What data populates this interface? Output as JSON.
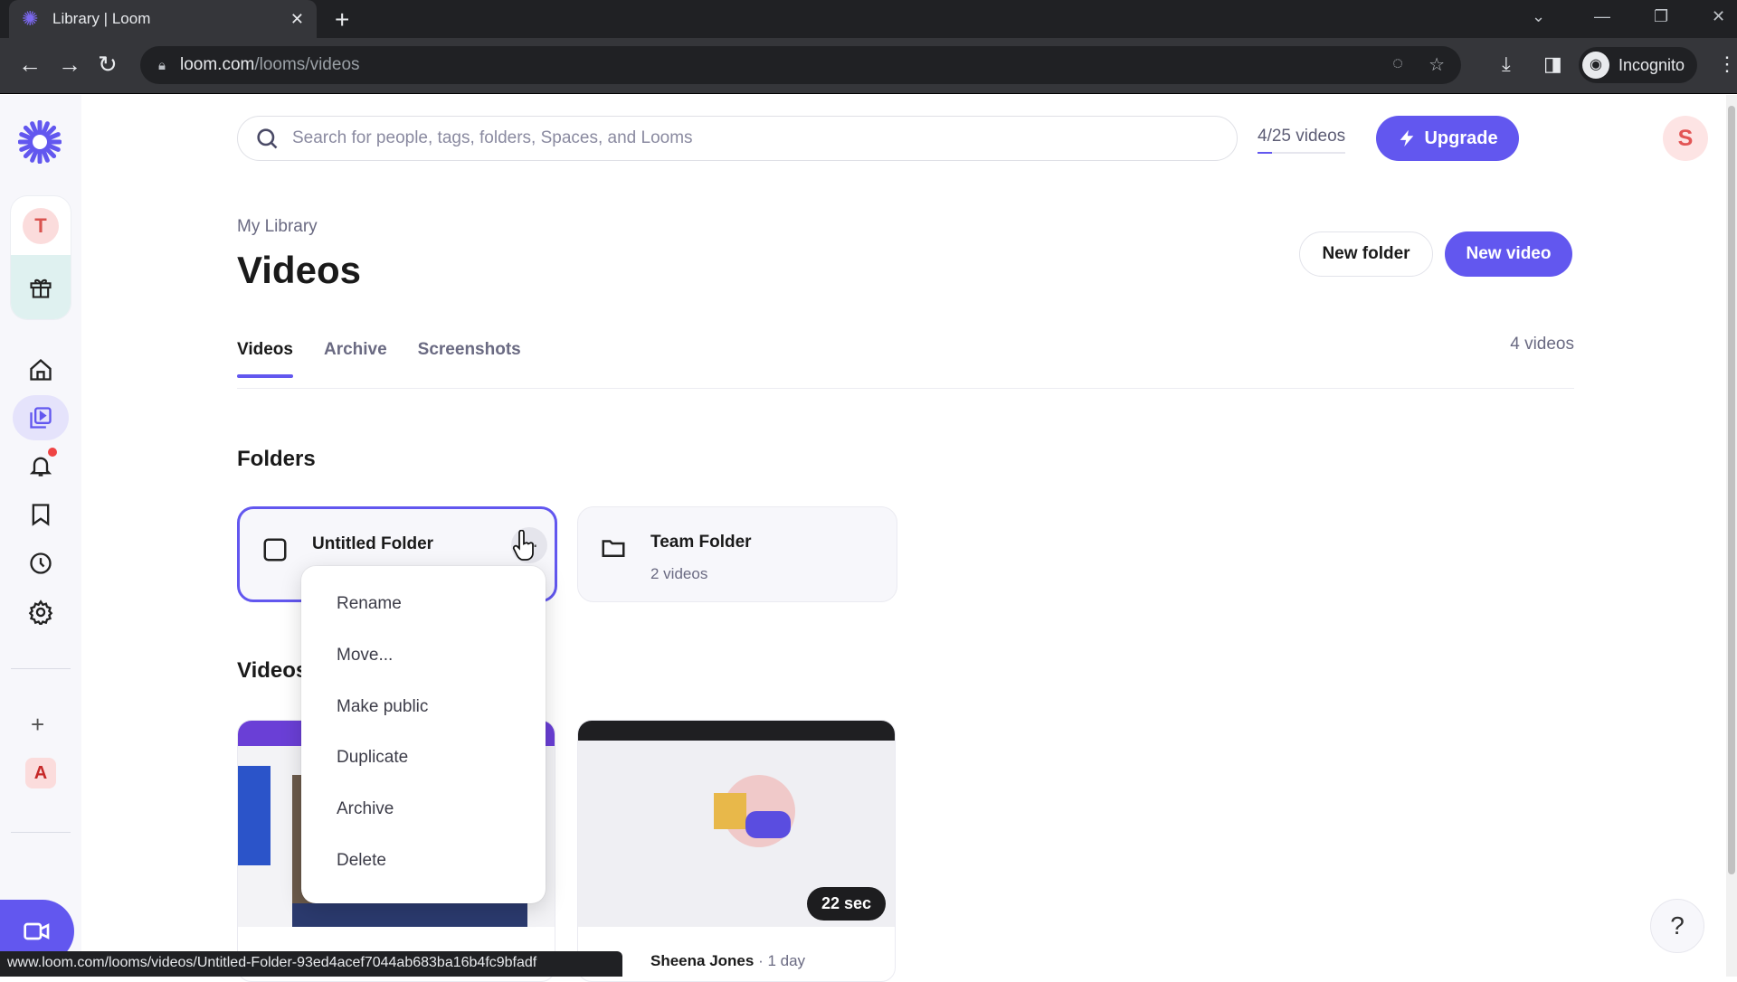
{
  "browser": {
    "tab_title": "Library | Loom",
    "url_host": "loom.com",
    "url_path": "/looms/videos",
    "profile_label": "Incognito",
    "status_url": "www.loom.com/looms/videos/Untitled-Folder-93ed4acef7044ab683ba16b4fc9bfadf"
  },
  "sidebar": {
    "workspace_avatar": "T",
    "space_avatar": "A",
    "items": [
      {
        "name": "home",
        "icon": "home-icon"
      },
      {
        "name": "library",
        "icon": "library-icon",
        "active": true
      },
      {
        "name": "notifications",
        "icon": "bell-icon",
        "badge": true
      },
      {
        "name": "watch-later",
        "icon": "bookmark-icon"
      },
      {
        "name": "history",
        "icon": "clock-icon"
      },
      {
        "name": "settings",
        "icon": "gear-icon"
      }
    ]
  },
  "topbar": {
    "search_placeholder": "Search for people, tags, folders, Spaces, and Looms",
    "quota": "4/25 videos",
    "upgrade_label": "Upgrade",
    "user_avatar": "S"
  },
  "header": {
    "breadcrumb": "My Library",
    "title": "Videos",
    "new_folder_label": "New folder",
    "new_video_label": "New video"
  },
  "tabs": [
    {
      "label": "Videos",
      "active": true
    },
    {
      "label": "Archive",
      "active": false
    },
    {
      "label": "Screenshots",
      "active": false
    }
  ],
  "video_count": "4 videos",
  "folders_heading": "Folders",
  "folders": [
    {
      "name": "Untitled Folder",
      "subtitle": "",
      "selected": true
    },
    {
      "name": "Team Folder",
      "subtitle": "2 videos",
      "selected": false
    }
  ],
  "videos_heading": "Videos",
  "videos": [
    {
      "author": "",
      "age": "",
      "duration": ""
    },
    {
      "author": "Sheena Jones",
      "age": "· 1 day",
      "duration": "22 sec"
    }
  ],
  "context_menu": {
    "items": [
      "Rename",
      "Move...",
      "Make public",
      "Duplicate",
      "Archive",
      "Delete"
    ]
  },
  "colors": {
    "brand": "#6257ef",
    "sidebar_bg": "#f7f7fb"
  }
}
